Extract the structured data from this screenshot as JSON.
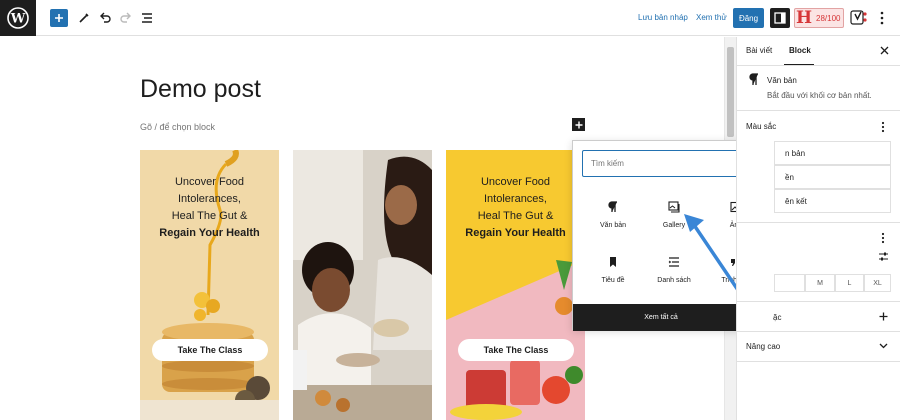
{
  "toolbar": {
    "save_draft": "Lưu bản nháp",
    "preview": "Xem thử",
    "publish": "Đăng",
    "seo_score": "28/100"
  },
  "post": {
    "title": "Demo post",
    "placeholder": "Gõ / để chọn block"
  },
  "cards": [
    {
      "line1": "Uncover Food",
      "line2": "Intolerances,",
      "line3": "Heal The Gut &",
      "line4": "Regain Your Health",
      "button": "Take The Class",
      "bg": "#f1d9a8"
    },
    {
      "bg": "#cfc7bc"
    },
    {
      "line1": "Uncover Food",
      "line2": "Intolerances,",
      "line3": "Heal The Gut &",
      "line4": "Regain Your Health",
      "button": "Take The Class",
      "bg": "#f7c930"
    }
  ],
  "inserter": {
    "search_placeholder": "Tìm kiếm",
    "blocks": [
      {
        "label": "Văn bản",
        "icon": "paragraph-icon"
      },
      {
        "label": "Gallery",
        "icon": "gallery-icon"
      },
      {
        "label": "Ảnh",
        "icon": "image-icon"
      },
      {
        "label": "Tiêu đề",
        "icon": "bookmark-icon"
      },
      {
        "label": "Danh sách",
        "icon": "list-icon"
      },
      {
        "label": "Trích dẫn",
        "icon": "quote-icon"
      }
    ],
    "view_all": "Xem tất cả"
  },
  "sidebar": {
    "tab_post": "Bài viết",
    "tab_block": "Block",
    "block_name": "Văn bản",
    "block_desc": "Bắt đầu với khối cơ bản nhất.",
    "colors_heading": "Màu sắc",
    "color_opt1": "n bản",
    "color_opt2": "ền",
    "color_opt3": "ên kết",
    "size_m": "M",
    "size_l": "L",
    "size_xl": "XL",
    "partial_label": "ặc",
    "advanced": "Nâng cao"
  },
  "colors": {
    "accent": "#2271b1",
    "dark": "#1e1e1e",
    "seo_red": "#d63638"
  }
}
